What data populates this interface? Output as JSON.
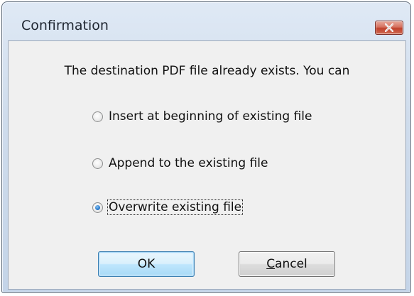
{
  "window": {
    "title": "Confirmation"
  },
  "dialog": {
    "message": "The destination PDF file already exists. You can",
    "options": [
      {
        "label": "Insert at beginning of existing file",
        "checked": false
      },
      {
        "label": "Append to the existing file",
        "checked": false
      },
      {
        "label": "Overwrite existing file",
        "checked": true
      }
    ],
    "buttons": {
      "ok_label": "OK",
      "cancel_first_letter": "C",
      "cancel_rest": "ancel"
    }
  },
  "colors": {
    "title_bar": "#cfdcec",
    "close_button": "#c0412c",
    "client_bg": "#f0f0f0",
    "radio_selected": "#2c7ed0",
    "default_button_border": "#3c7fb1"
  }
}
